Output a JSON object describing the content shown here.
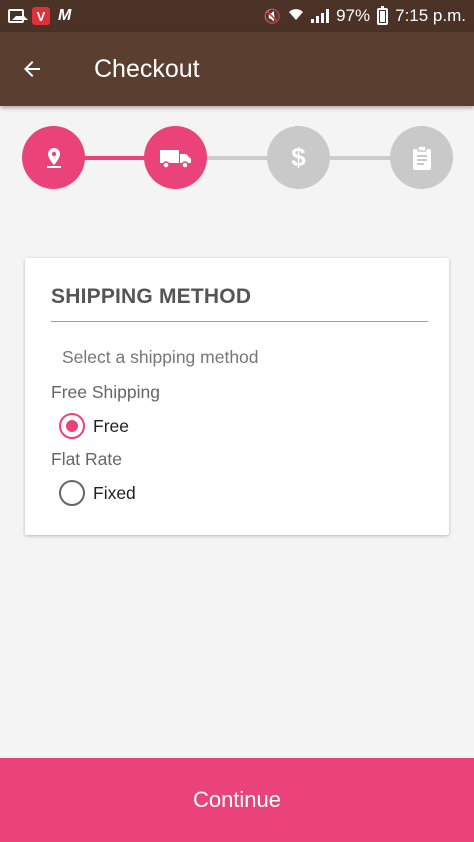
{
  "status_bar": {
    "vivo_letter": "V",
    "m_letter": "M",
    "battery": "97%",
    "time": "7:15 p.m."
  },
  "app_bar": {
    "back_icon": "arrow-back",
    "title": "Checkout"
  },
  "stepper": {
    "steps": [
      {
        "icon": "location-pin",
        "state": "done"
      },
      {
        "icon": "truck",
        "state": "active"
      },
      {
        "icon": "dollar",
        "state": "inactive",
        "glyph": "$"
      },
      {
        "icon": "clipboard",
        "state": "inactive"
      }
    ],
    "accent_color": "#ea4379",
    "inactive_color": "#c9c9c9"
  },
  "shipping": {
    "title": "SHIPPING METHOD",
    "subtitle": "Select a shipping method",
    "groups": [
      {
        "label": "Free Shipping",
        "option": "Free",
        "selected": true
      },
      {
        "label": "Flat Rate",
        "option": "Fixed",
        "selected": false
      }
    ]
  },
  "footer": {
    "continue_label": "Continue"
  },
  "colors": {
    "status_bar": "#4b3226",
    "app_bar": "#5a3e2f",
    "accent": "#ea4379",
    "background": "#f4f4f4"
  }
}
